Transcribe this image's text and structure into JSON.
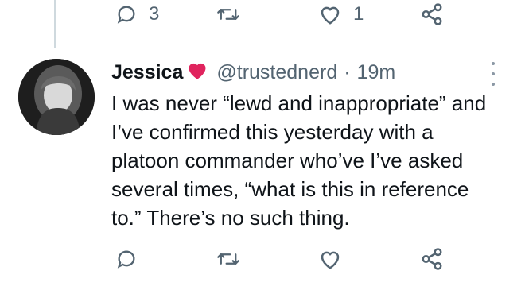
{
  "top_actions": {
    "reply_count": "3",
    "retweet_count": "",
    "like_count": "1"
  },
  "tweet": {
    "display_name": "Jessica",
    "name_emoji": "heart-icon",
    "handle": "@trustednerd",
    "separator": "·",
    "time": "19m",
    "text": "I was never “lewd and inappropriate” and\nI’ve confirmed this yesterday with a\nplatoon commander who’ve I’ve asked\nseveral times, “what is this in reference\nto.” There’s no such thing."
  },
  "colors": {
    "icon_gray": "#536471",
    "heart_red": "#e0245e",
    "thread_line": "#cfd9de"
  }
}
